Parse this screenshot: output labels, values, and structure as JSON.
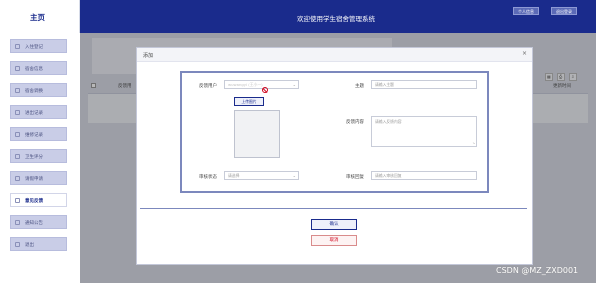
{
  "header": {
    "logo_label": "主页",
    "title": "欢迎使用学生宿舍管理系统",
    "buttons": [
      "个人信息",
      "退出登录"
    ]
  },
  "sidebar": {
    "items": [
      {
        "label": "入住登记",
        "icon": "book-icon"
      },
      {
        "label": "宿舍信息",
        "icon": "phone-icon"
      },
      {
        "label": "宿舍调换",
        "icon": "swap-icon"
      },
      {
        "label": "进出记录",
        "icon": "list-icon"
      },
      {
        "label": "维修记录",
        "icon": "eye-icon"
      },
      {
        "label": "卫生评分",
        "icon": "phone-icon"
      },
      {
        "label": "请假申请",
        "icon": "book-icon"
      },
      {
        "label": "意见反馈",
        "icon": "feedback-icon"
      },
      {
        "label": "通知公告",
        "icon": "bell-icon"
      },
      {
        "label": "退出",
        "icon": "exit-icon"
      }
    ],
    "active_index": 7
  },
  "table": {
    "col_feedback_user": "反馈用",
    "col_update_time": "更新时间"
  },
  "dialog": {
    "title": "添加",
    "close": "×",
    "fields": {
      "feedback_user": {
        "label": "反馈用户",
        "value": "wuwangyi (王小一)"
      },
      "upload": {
        "label": "上传图片"
      },
      "subject": {
        "label": "主题",
        "placeholder": "请输入主题"
      },
      "content": {
        "label": "反馈内容",
        "placeholder": "请输入反馈内容"
      },
      "review_status": {
        "label": "审核状态",
        "placeholder": "请选择"
      },
      "review_reply": {
        "label": "审核回复",
        "placeholder": "请输入审核回复"
      }
    },
    "confirm_label": "确认",
    "cancel_label": "取消"
  },
  "watermark": "CSDN @MZ_ZXD001",
  "colors": {
    "primary": "#1a2b8c",
    "danger": "#d0021b",
    "sidebar_item": "#c9cde7"
  }
}
